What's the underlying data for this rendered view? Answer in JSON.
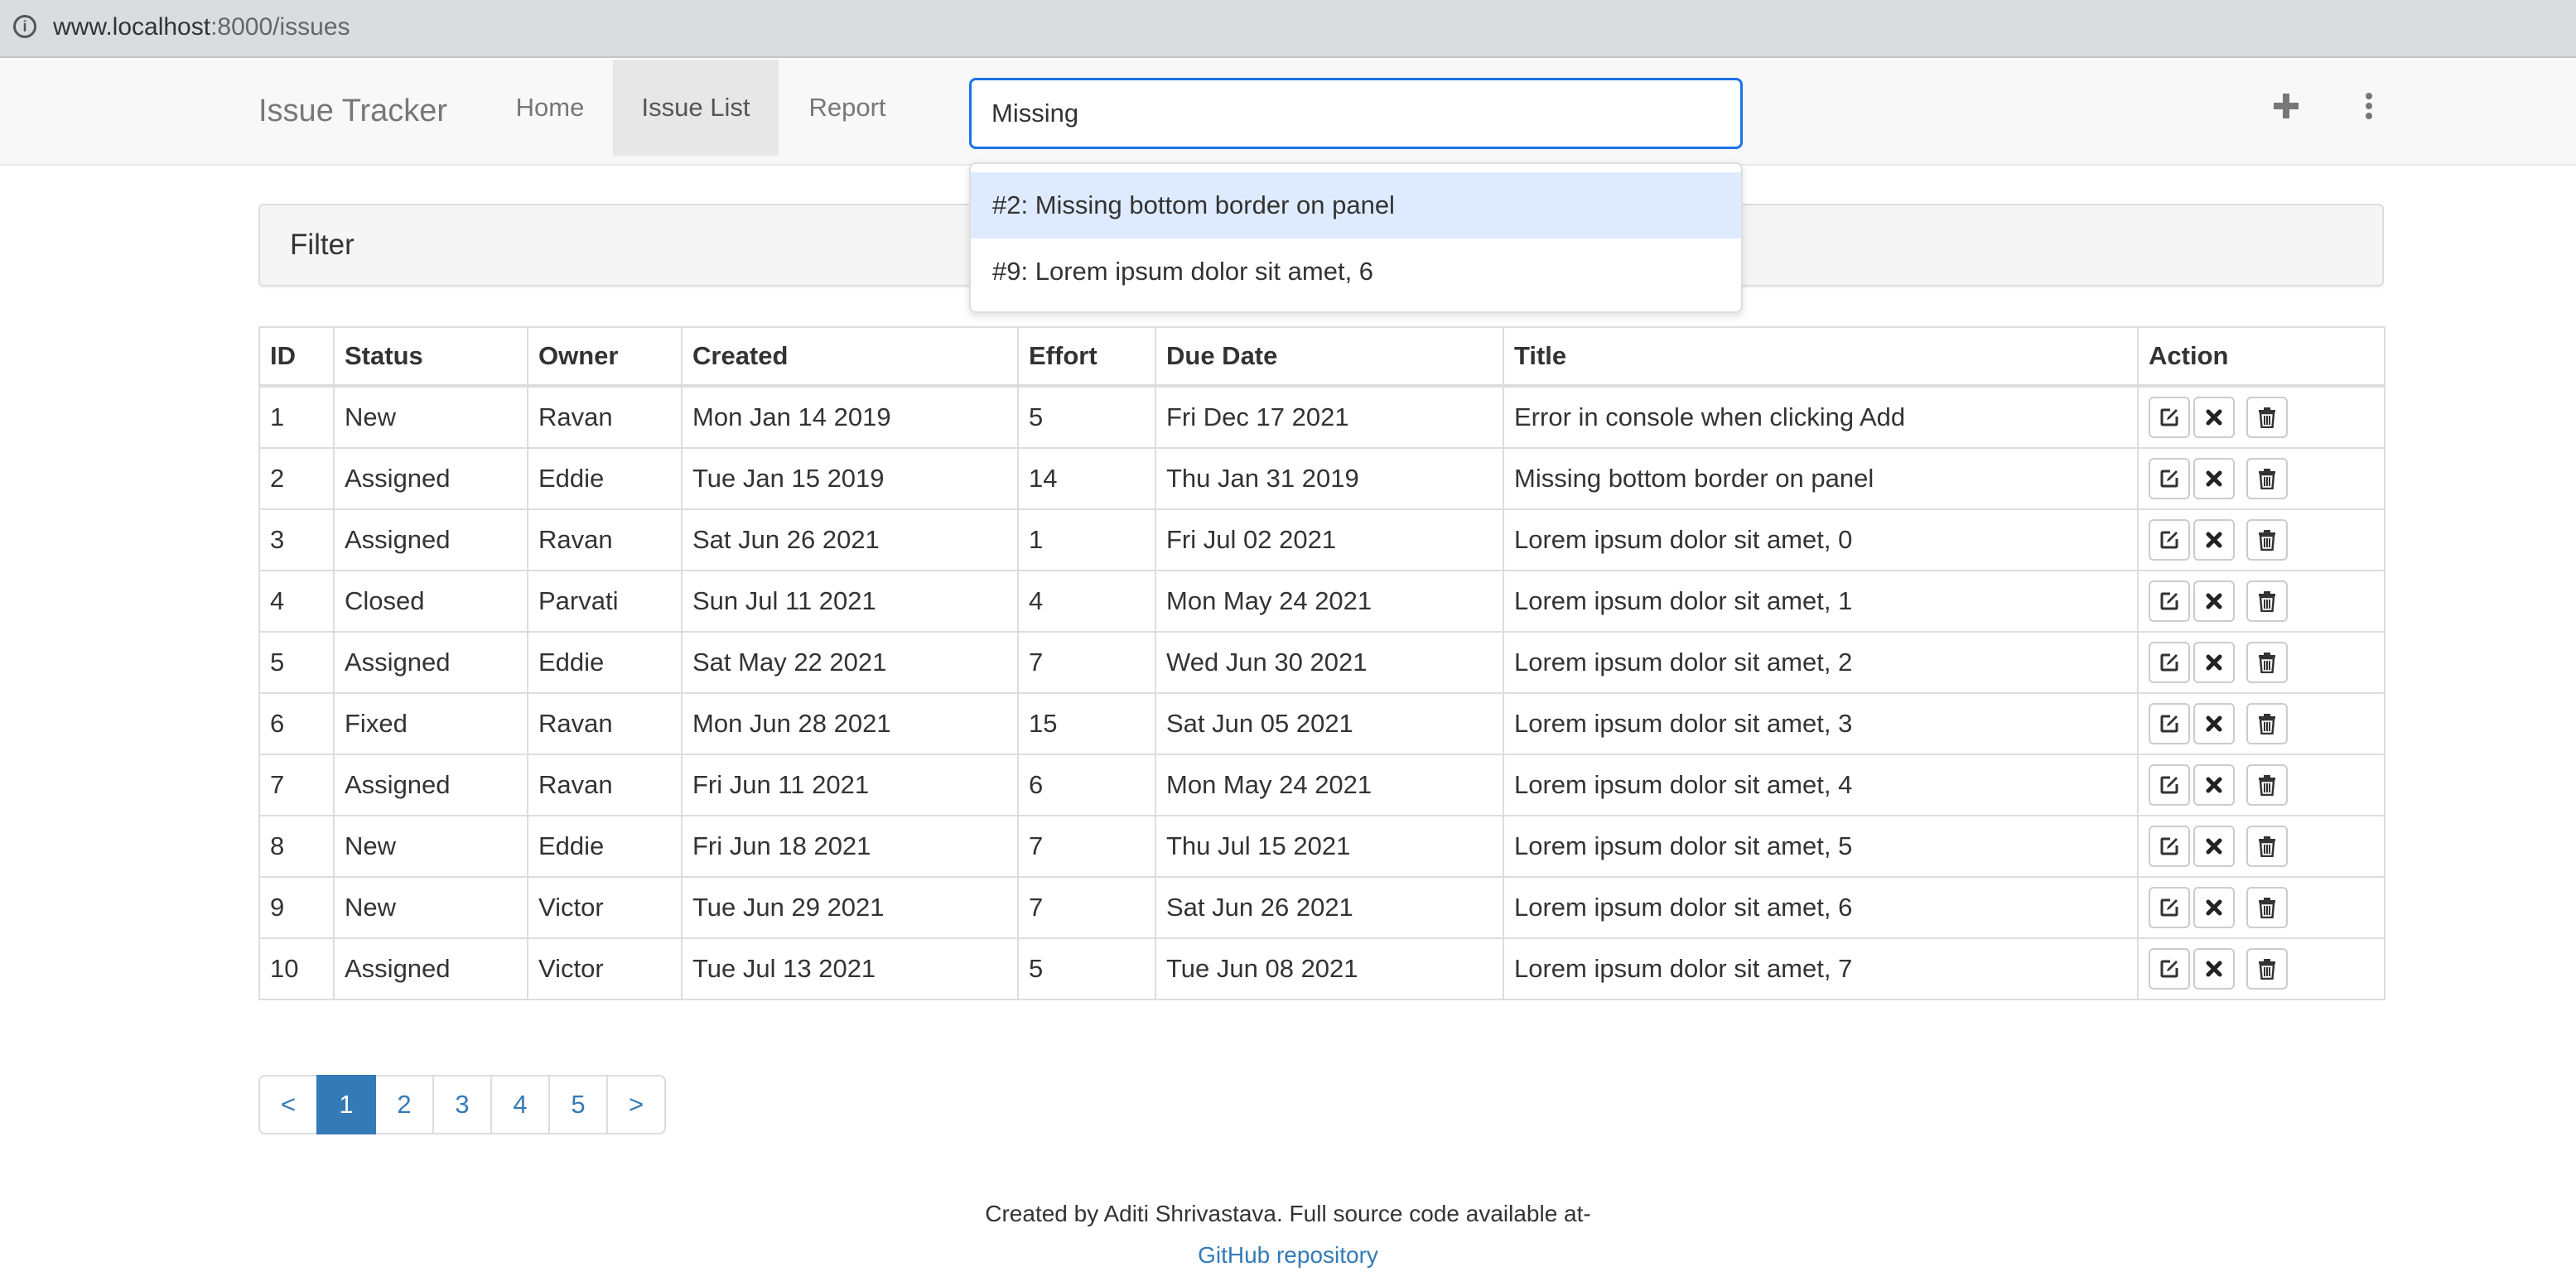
{
  "browser": {
    "url_host": "www.localhost",
    "url_path": ":8000/issues"
  },
  "navbar": {
    "brand": "Issue Tracker",
    "links": [
      {
        "label": "Home"
      },
      {
        "label": "Issue List",
        "active": true
      },
      {
        "label": "Report"
      }
    ],
    "search_value": "Missing",
    "add_icon": "plus-icon",
    "menu_icon": "more-vertical-icon"
  },
  "search_dropdown": {
    "items": [
      {
        "label": "#2: Missing bottom border on panel",
        "selected": true
      },
      {
        "label": "#9: Lorem ipsum dolor sit amet, 6",
        "selected": false
      }
    ]
  },
  "filter": {
    "title": "Filter"
  },
  "table": {
    "headers": [
      "ID",
      "Status",
      "Owner",
      "Created",
      "Effort",
      "Due Date",
      "Title",
      "Action"
    ],
    "rows": [
      {
        "id": "1",
        "status": "New",
        "owner": "Ravan",
        "created": "Mon Jan 14 2019",
        "effort": "5",
        "due": "Fri Dec 17 2021",
        "title": "Error in console when clicking Add"
      },
      {
        "id": "2",
        "status": "Assigned",
        "owner": "Eddie",
        "created": "Tue Jan 15 2019",
        "effort": "14",
        "due": "Thu Jan 31 2019",
        "title": "Missing bottom border on panel"
      },
      {
        "id": "3",
        "status": "Assigned",
        "owner": "Ravan",
        "created": "Sat Jun 26 2021",
        "effort": "1",
        "due": "Fri Jul 02 2021",
        "title": "Lorem ipsum dolor sit amet, 0"
      },
      {
        "id": "4",
        "status": "Closed",
        "owner": "Parvati",
        "created": "Sun Jul 11 2021",
        "effort": "4",
        "due": "Mon May 24 2021",
        "title": "Lorem ipsum dolor sit amet, 1"
      },
      {
        "id": "5",
        "status": "Assigned",
        "owner": "Eddie",
        "created": "Sat May 22 2021",
        "effort": "7",
        "due": "Wed Jun 30 2021",
        "title": "Lorem ipsum dolor sit amet, 2"
      },
      {
        "id": "6",
        "status": "Fixed",
        "owner": "Ravan",
        "created": "Mon Jun 28 2021",
        "effort": "15",
        "due": "Sat Jun 05 2021",
        "title": "Lorem ipsum dolor sit amet, 3"
      },
      {
        "id": "7",
        "status": "Assigned",
        "owner": "Ravan",
        "created": "Fri Jun 11 2021",
        "effort": "6",
        "due": "Mon May 24 2021",
        "title": "Lorem ipsum dolor sit amet, 4"
      },
      {
        "id": "8",
        "status": "New",
        "owner": "Eddie",
        "created": "Fri Jun 18 2021",
        "effort": "7",
        "due": "Thu Jul 15 2021",
        "title": "Lorem ipsum dolor sit amet, 5"
      },
      {
        "id": "9",
        "status": "New",
        "owner": "Victor",
        "created": "Tue Jun 29 2021",
        "effort": "7",
        "due": "Sat Jun 26 2021",
        "title": "Lorem ipsum dolor sit amet, 6"
      },
      {
        "id": "10",
        "status": "Assigned",
        "owner": "Victor",
        "created": "Tue Jul 13 2021",
        "effort": "5",
        "due": "Tue Jun 08 2021",
        "title": "Lorem ipsum dolor sit amet, 7"
      }
    ],
    "action_icons": [
      "edit-icon",
      "close-icon",
      "trash-icon"
    ]
  },
  "pagination": {
    "items": [
      {
        "label": "<"
      },
      {
        "label": "1",
        "active": true
      },
      {
        "label": "2"
      },
      {
        "label": "3"
      },
      {
        "label": "4"
      },
      {
        "label": "5"
      },
      {
        "label": ">"
      }
    ]
  },
  "footer": {
    "text": "Created by Aditi Shrivastava. Full source code available at-",
    "link": "GitHub repository"
  },
  "colors": {
    "accent": "#337ab7",
    "search_focus": "#1a73e8",
    "dropdown_selected": "#deebff"
  }
}
